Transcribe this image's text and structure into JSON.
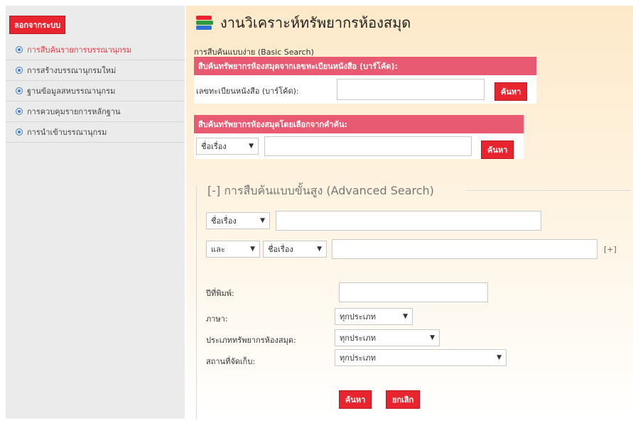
{
  "sidebar": {
    "logout_label": "ลอกจากระบบ",
    "items": [
      {
        "label": "การสืบค้นรายการบรรณานุกรม",
        "active": true
      },
      {
        "label": "การสร้างบรรณานุกรมใหม่",
        "active": false
      },
      {
        "label": "ฐานข้อมูลสหบรรณานุกรม",
        "active": false
      },
      {
        "label": "การควบคุมรายการหลักฐาน",
        "active": false
      },
      {
        "label": "การนำเข้าบรรณานุกรม",
        "active": false
      }
    ]
  },
  "header": {
    "title": "งานวิเคราะห์ทรัพยากรห้องสมุด",
    "icon": "books-icon"
  },
  "basic_search": {
    "label": "การสืบค้นแบบง่าย (Basic Search)",
    "barcode_panel": {
      "heading": "สืบค้นทรัพยากรห้องสมุดจากเลขทะเบียนหนังสือ (บาร์โค้ด):",
      "field_label": "เลขทะเบียนหนังสือ (บาร์โค้ด):",
      "value": "",
      "button": "ค้นหา"
    },
    "keyword_panel": {
      "heading": "สืบค้นทรัพยากรห้องสมุดโดยเลือกจากคำค้น:",
      "select_value": "ชื่อเรื่อง",
      "value": "",
      "button": "ค้นหา"
    }
  },
  "advanced_search": {
    "legend": "[-] การสืบค้นแบบขั้นสูง (Advanced Search)",
    "row1_select": "ชื่อเรื่อง",
    "row1_value": "",
    "row2_operator": "และ",
    "row2_select": "ชื่อเรื่อง",
    "row2_value": "",
    "add_row": "[+]",
    "year_label": "ปีที่พิมพ์:",
    "year_value": "",
    "language_label": "ภาษา:",
    "language_value": "ทุกประเภท",
    "type_label": "ประเภททรัพยากรห้องสมุด:",
    "type_value": "ทุกประเภท",
    "location_label": "สถานที่จัดเก็บ:",
    "location_value": "ทุกประเภท",
    "search_button": "ค้นหา",
    "cancel_button": "ยกเลิก"
  },
  "colors": {
    "accent_red": "#e8252f",
    "panel_header": "#e85a71",
    "active_menu": "#e63946",
    "sidebar_bg": "#ebebeb"
  }
}
